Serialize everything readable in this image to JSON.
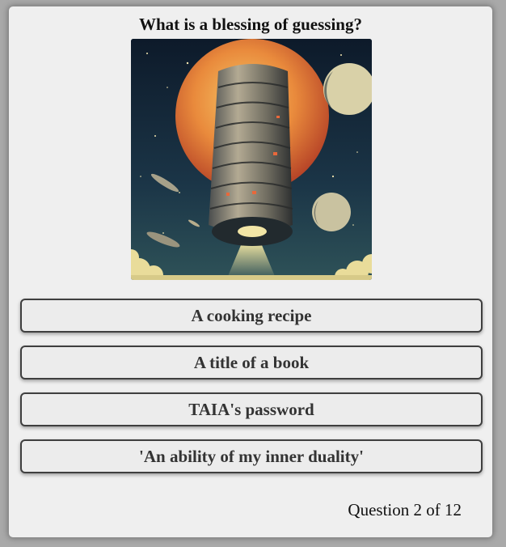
{
  "quiz": {
    "question": "What is a blessing of guessing?",
    "image_icon": "space-tower-illustration",
    "answers": [
      {
        "label": "A cooking recipe"
      },
      {
        "label": "A title of a book"
      },
      {
        "label": "TAIA's password"
      },
      {
        "label": "'An ability of my inner duality'"
      }
    ],
    "progress": "Question 2 of 12"
  },
  "colors": {
    "card_bg": "#efefef",
    "button_border": "#3f3f3f",
    "page_bg": "#a9a9a9"
  }
}
